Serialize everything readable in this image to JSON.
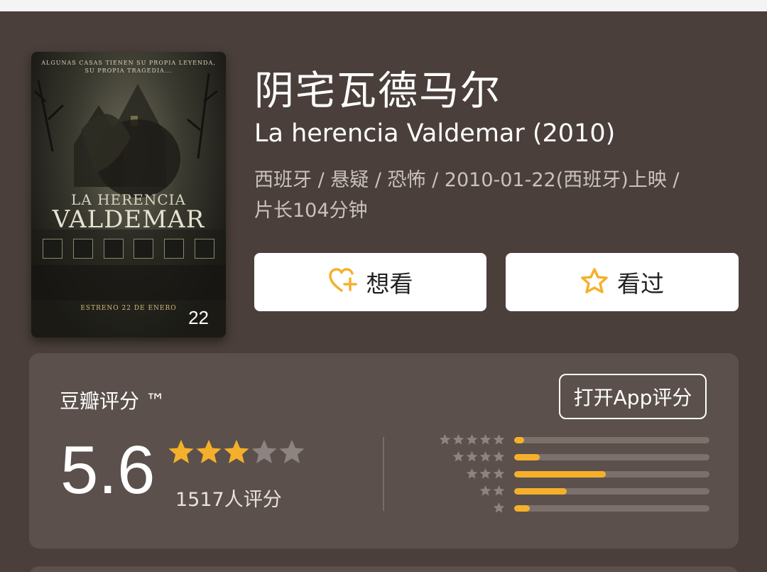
{
  "movie": {
    "title_cn": "阴宅瓦德马尔",
    "title_original": "La herencia Valdemar (2010)",
    "meta_line1": "西班牙 / 悬疑 / 恐怖 / 2010-01-22(西班牙)上映 /",
    "meta_line2": "片长104分钟"
  },
  "poster": {
    "tagline_1": "ALGUNAS CASAS TIENEN SU PROPIA LEYENDA,",
    "tagline_2": "SU PROPIA TRAGEDIA...",
    "title_1": "LA HERENCIA",
    "title_2": "VALDEMAR",
    "release": "ESTRENO 22 DE ENERO",
    "photo_count": "22"
  },
  "actions": {
    "want_label": "想看",
    "seen_label": "看过"
  },
  "rating": {
    "label": "豆瓣评分 ™",
    "open_app_label": "打开App评分",
    "score": "5.6",
    "stars_filled": 3,
    "stars_total": 5,
    "count": "1517人评分",
    "distribution": [
      {
        "stars": 5,
        "fraction": 0.05
      },
      {
        "stars": 4,
        "fraction": 0.13
      },
      {
        "stars": 3,
        "fraction": 0.47
      },
      {
        "stars": 2,
        "fraction": 0.27
      },
      {
        "stars": 1,
        "fraction": 0.08
      }
    ]
  },
  "colors": {
    "background": "#4a3f3a",
    "card": "#5b504b",
    "star_filled": "#f5b02b",
    "star_empty": "#8c8480",
    "bar_fill": "#f5b02b",
    "bar_track": "#7a716b",
    "icon_accent": "#f5b02b"
  },
  "icons": {
    "want": "heart-plus-icon",
    "seen": "star-outline-icon"
  }
}
